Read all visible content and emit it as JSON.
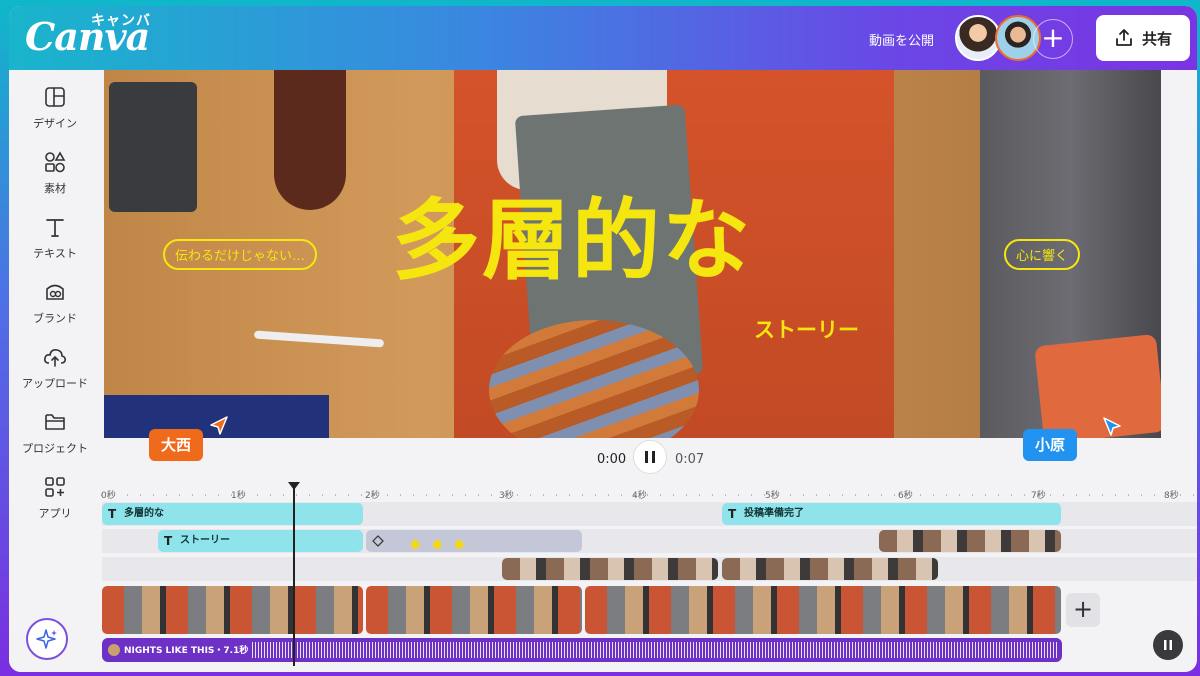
{
  "header": {
    "logo": "Canva",
    "logo_kana": "キャンバ",
    "publish_label": "動画を公開",
    "share_label": "共有"
  },
  "sidebar": {
    "items": [
      {
        "label": "デザイン",
        "icon": "layout-icon"
      },
      {
        "label": "素材",
        "icon": "elements-icon"
      },
      {
        "label": "テキスト",
        "icon": "text-icon"
      },
      {
        "label": "ブランド",
        "icon": "brand-icon"
      },
      {
        "label": "アップロード",
        "icon": "upload-icon"
      },
      {
        "label": "プロジェクト",
        "icon": "folder-icon"
      },
      {
        "label": "アプリ",
        "icon": "apps-icon"
      }
    ]
  },
  "canvas": {
    "headline": "多層的な",
    "subheadline": "ストーリー",
    "left_pill": "伝わるだけじゃない…",
    "right_pill": "心に響く",
    "collaborator_left": "大西",
    "collaborator_right": "小原"
  },
  "player": {
    "current_time": "0:00",
    "total_time": "0:07"
  },
  "timeline": {
    "ruler": [
      "0秒",
      "1秒",
      "2秒",
      "3秒",
      "4秒",
      "5秒",
      "6秒",
      "7秒",
      "8秒"
    ],
    "text_track_1": [
      {
        "label": "多層的な"
      },
      {
        "label": "投稿準備完了"
      }
    ],
    "text_track_2": [
      {
        "label": "ストーリー"
      }
    ],
    "audio_label": "NIGHTS LIKE THIS・7.1秒"
  },
  "colors": {
    "accent_yellow": "#f5e60f",
    "collaborator_orange": "#f06a1c",
    "collaborator_blue": "#2192f0",
    "audio_purple": "#6d31c6",
    "text_track": "#8fe3ea"
  }
}
